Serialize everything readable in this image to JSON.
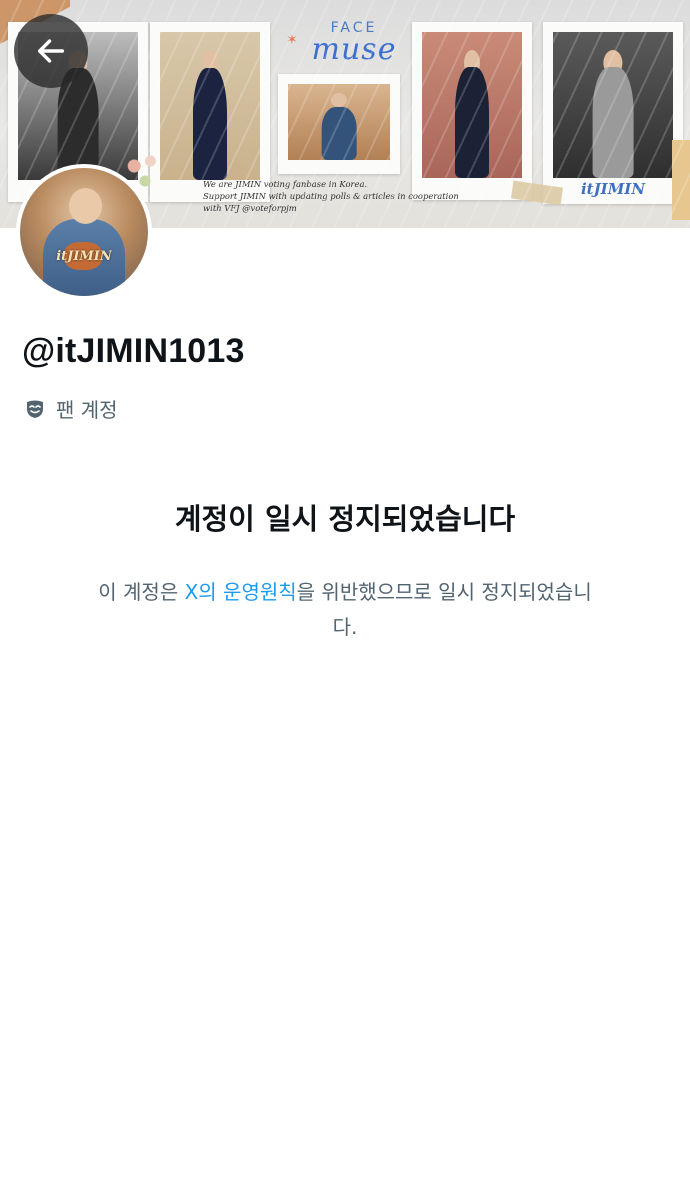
{
  "banner": {
    "brand_top": "FACE",
    "brand_main": "muse",
    "description_lines": [
      "We are JIMIN voting fanbase in Korea.",
      "Support JIMIN with updating polls & articles in cooperation",
      "with VFJ @voteforpjm"
    ],
    "polaroid_caption": "itJIMIN"
  },
  "avatar": {
    "label": "itJIMIN"
  },
  "profile": {
    "handle": "@itJIMIN1013",
    "account_type": "팬 계정",
    "account_type_icon": "fan-account-mask-icon"
  },
  "suspension": {
    "title": "계정이 일시 정지되었습니다",
    "body_prefix": "이 계정은 ",
    "rules_link": "X의 운영원칙",
    "body_suffix": "을 위반했으므로 일시 정지되었습니다.",
    "link_color": "#1d9bf0"
  },
  "navigation": {
    "back_icon": "arrow-left-icon"
  }
}
